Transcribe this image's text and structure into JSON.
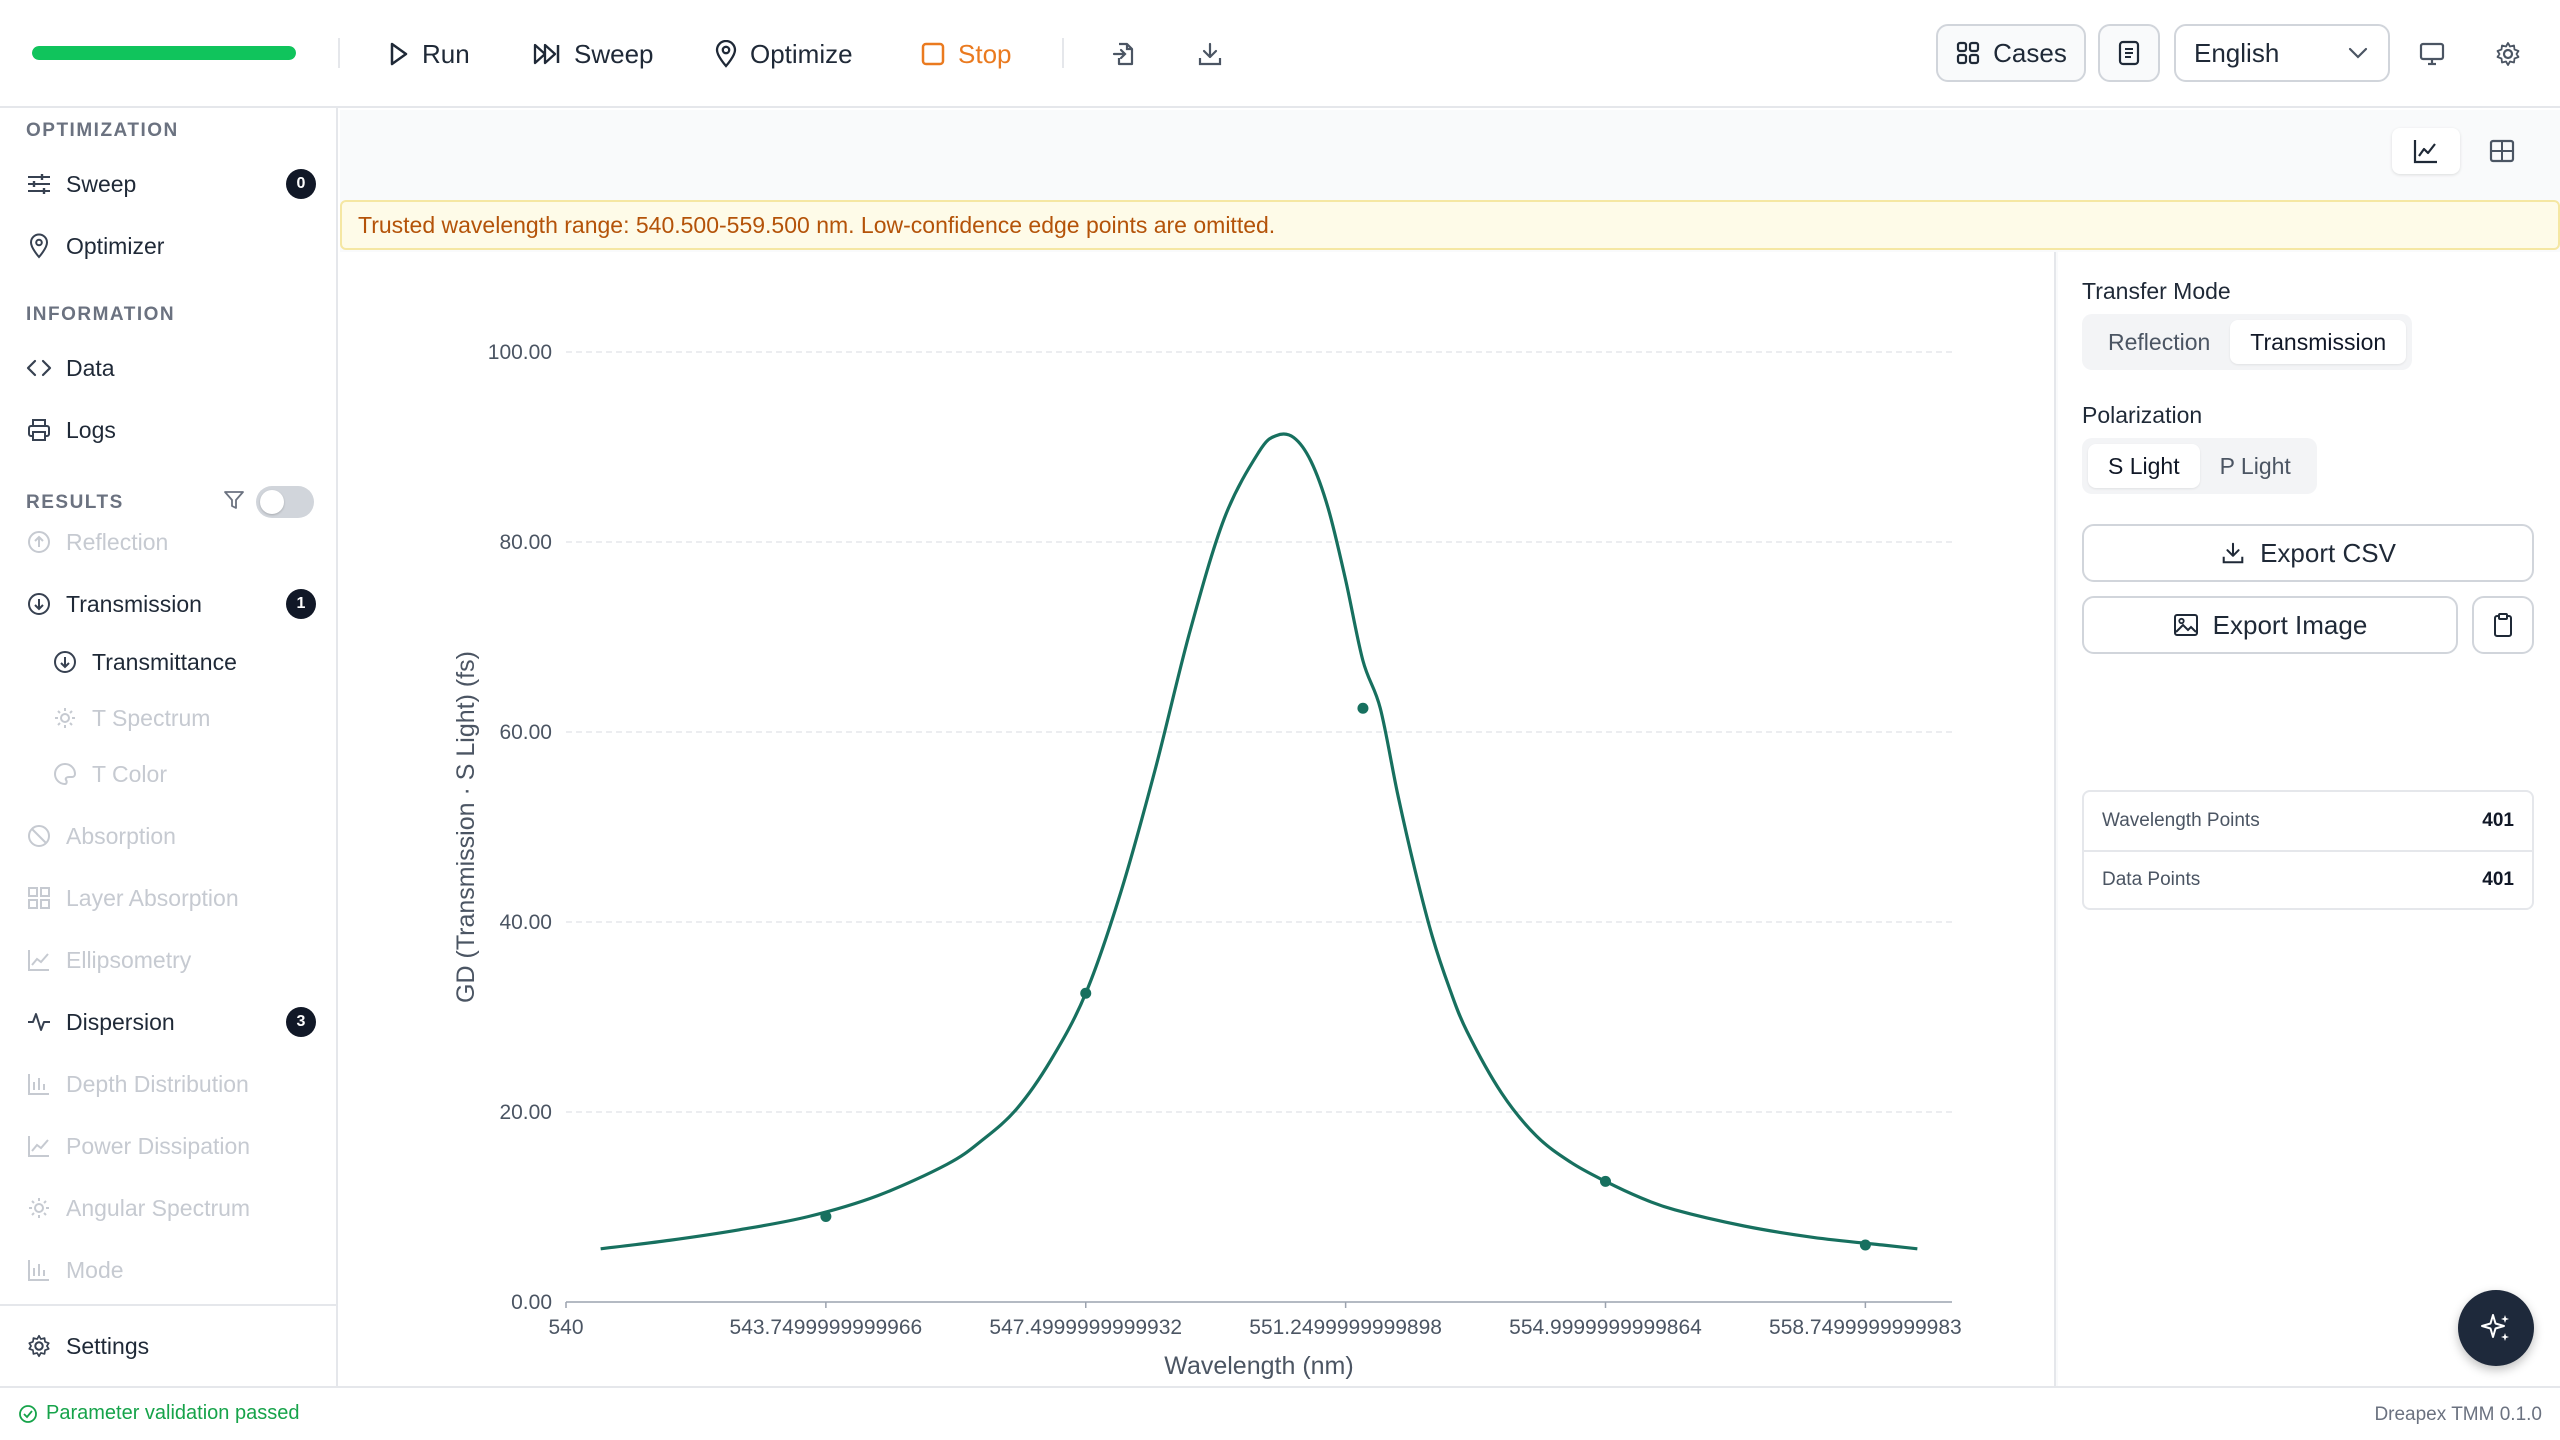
{
  "toolbar": {
    "progress": 1.0,
    "run_label": "Run",
    "sweep_label": "Sweep",
    "optimize_label": "Optimize",
    "stop_label": "Stop",
    "cases_label": "Cases",
    "language": "English"
  },
  "sidebar": {
    "optimization_header": "OPTIMIZATION",
    "sweep": {
      "label": "Sweep",
      "badge": "0"
    },
    "optimizer": {
      "label": "Optimizer"
    },
    "information_header": "INFORMATION",
    "data": {
      "label": "Data"
    },
    "logs": {
      "label": "Logs"
    },
    "results_header": "RESULTS",
    "reflection": {
      "label": "Reflection"
    },
    "transmission": {
      "label": "Transmission",
      "badge": "1"
    },
    "transmittance": {
      "label": "Transmittance"
    },
    "t_spectrum": {
      "label": "T Spectrum"
    },
    "t_color": {
      "label": "T Color"
    },
    "absorption": {
      "label": "Absorption"
    },
    "layer_absorption": {
      "label": "Layer Absorption"
    },
    "ellipsometry": {
      "label": "Ellipsometry"
    },
    "dispersion": {
      "label": "Dispersion",
      "badge": "3"
    },
    "depth_distribution": {
      "label": "Depth Distribution"
    },
    "power_dissipation": {
      "label": "Power Dissipation"
    },
    "angular_spectrum": {
      "label": "Angular Spectrum"
    },
    "mode": {
      "label": "Mode"
    },
    "settings": {
      "label": "Settings"
    }
  },
  "main": {
    "warning": "Trusted wavelength range: 540.500-559.500 nm. Low-confidence edge points are omitted."
  },
  "right_panel": {
    "transfer_mode_label": "Transfer Mode",
    "transfer_modes": [
      "Reflection",
      "Transmission"
    ],
    "transfer_mode_selected": "Transmission",
    "polarization_label": "Polarization",
    "polarizations": [
      "S Light",
      "P Light"
    ],
    "polarization_selected": "S Light",
    "export_csv": "Export CSV",
    "export_image": "Export Image",
    "stats": {
      "wavelength_points_label": "Wavelength Points",
      "wavelength_points": "401",
      "data_points_label": "Data Points",
      "data_points": "401"
    }
  },
  "status": {
    "validation": "Parameter validation passed",
    "version": "Dreapex TMM 0.1.0"
  },
  "chart_data": {
    "type": "line",
    "xlabel": "Wavelength (nm)",
    "ylabel": "GD (Transmission · S Light) (fs)",
    "xlim": [
      540,
      560
    ],
    "ylim": [
      0,
      100
    ],
    "x_ticks": [
      "540",
      "543.7499999999966",
      "547.4999999999932",
      "551.2499999999898",
      "554.9999999999864",
      "558.7499999999983"
    ],
    "x_tick_values": [
      540,
      543.75,
      547.5,
      551.25,
      555.0,
      558.75
    ],
    "y_ticks": [
      "0.00",
      "20.00",
      "40.00",
      "60.00",
      "80.00",
      "100.00"
    ],
    "y_tick_values": [
      0,
      20,
      40,
      60,
      80,
      100
    ],
    "grid": true,
    "series": [
      {
        "color": "#17705f",
        "x": [
          540.5,
          541.5,
          542.5,
          543.5,
          544.5,
          545.5,
          546.0,
          546.5,
          547.0,
          547.5,
          548.0,
          548.5,
          549.0,
          549.5,
          550.0,
          550.25,
          550.5,
          550.75,
          551.0,
          551.25,
          551.5,
          551.75,
          552.0,
          552.25,
          552.5,
          552.75,
          553.0,
          553.5,
          554.0,
          554.5,
          555.0,
          555.5,
          556.0,
          557.0,
          558.0,
          559.0,
          559.5
        ],
        "values": [
          5.6,
          6.5,
          7.6,
          9.0,
          11.2,
          14.5,
          17.0,
          20.3,
          25.5,
          32.5,
          43.0,
          56.0,
          70.5,
          82.5,
          89.5,
          91.2,
          91.0,
          88.5,
          83.5,
          76.0,
          67.5,
          62.5,
          53.5,
          45.5,
          38.5,
          33.0,
          28.5,
          22.0,
          17.5,
          14.7,
          12.7,
          11.0,
          9.7,
          8.0,
          6.8,
          6.0,
          5.6
        ]
      }
    ],
    "markers": {
      "x": [
        543.75,
        547.5,
        551.5,
        555.0,
        558.75
      ],
      "y": [
        9.0,
        32.5,
        62.5,
        12.7,
        6.0
      ]
    }
  }
}
